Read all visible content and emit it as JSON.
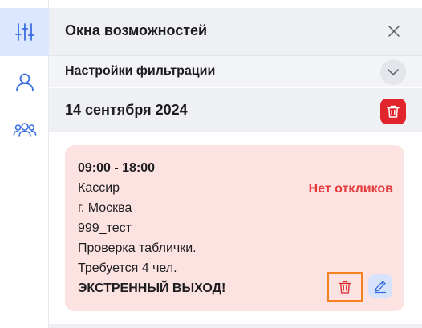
{
  "sidebar": {
    "items": [
      {
        "icon": "sliders-icon",
        "active": true
      },
      {
        "icon": "user-icon",
        "active": false
      },
      {
        "icon": "users-group-icon",
        "active": false
      }
    ]
  },
  "header": {
    "title": "Окна возможностей",
    "close_icon": "close-icon"
  },
  "filters": {
    "title": "Настройки фильтрации",
    "toggle_icon": "chevron-down-icon"
  },
  "day": {
    "date": "14 сентября 2024",
    "delete_icon": "trash-icon"
  },
  "shift_card": {
    "time": "09:00 - 18:00",
    "position": "Кассир",
    "city": "г. Москва",
    "store": "999_тест",
    "comment": "Проверка таблички.",
    "required": "Требуется 4 чел.",
    "emergency": "ЭКСТРЕННЫЙ ВЫХОД!",
    "status": "Нет откликов",
    "delete_icon": "trash-icon",
    "edit_icon": "pencil-icon"
  },
  "colors": {
    "active_nav_bg": "#dbe6ff",
    "accent_blue": "#3b6fe0",
    "danger_red": "#e0262b",
    "status_red": "#e53b3b",
    "card_bg": "#fde2e2",
    "highlight_orange": "#f5821f"
  }
}
